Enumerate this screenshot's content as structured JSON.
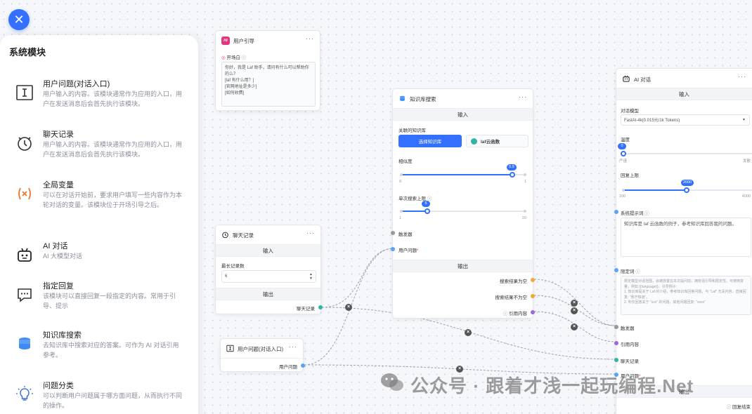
{
  "panel": {
    "title": "系统模块",
    "modules": [
      {
        "name": "用户问题(对话入口)",
        "desc": "用户输入的内容。该模块通常作为应用的入口，用户在发送消息后会首先执行该模块。",
        "icon": "text-cursor-icon"
      },
      {
        "name": "聊天记录",
        "desc": "用户输入的内容。该模块通常作为应用的入口，用户在发送消息后会首先执行该模块。",
        "icon": "history-clock-icon"
      },
      {
        "name": "全局变量",
        "desc": "可以在对话开始前，要求用户填写一些内容作为本轮对话的变量。该模块位于开场引导之后。",
        "icon": "variable-icon"
      },
      {
        "name": "AI 对话",
        "desc": "AI 大模型对话",
        "icon": "robot-icon"
      },
      {
        "name": "指定回复",
        "desc": "该模块可以直接回复一段指定的内容。常用于引导、提示",
        "icon": "reply-bubble-icon"
      },
      {
        "name": "知识库搜索",
        "desc": "去知识库中搜索对应的答案。可作为 AI 对话引用参考。",
        "icon": "database-icon"
      },
      {
        "name": "问题分类",
        "desc": "可以判断用户问题属于哪方面问题，从而执行不同的操作。",
        "icon": "bulb-icon"
      }
    ]
  },
  "guide_node": {
    "title": "用户引导",
    "badge": "Hi",
    "field_label": "开场白",
    "content": "你好，我是 Laf 助手，请问有什么可以帮助你的么？\n[laf 有什么用？]\n[官网地址是多少]\n[如何收费]"
  },
  "history_node": {
    "title": "聊天记录",
    "input_bar": "输入",
    "field_label": "最长记录数",
    "value": "6",
    "output_bar": "输出",
    "output_label": "聊天记录"
  },
  "question_node": {
    "title": "用户问题(对话入口)",
    "output_label": "用户问题"
  },
  "kb_node": {
    "title": "知识库搜索",
    "input_bar": "输入",
    "kb_label": "关联的知识库",
    "select_button": "选择知识库",
    "kb_chip": "laf云函数",
    "similarity_label": "相似度",
    "similarity": {
      "min": "0",
      "max": "1",
      "value": 0.9,
      "tip": "0.9"
    },
    "limit_label": "单次搜索上限",
    "limit": {
      "min": "1",
      "max": "20",
      "value": 5,
      "tip": "5"
    },
    "trigger_label": "触发器",
    "question_label": "用户问题",
    "required_mark": "*",
    "output_bar": "输出",
    "outputs": [
      "搜索结果为空",
      "搜索结果不为空",
      "引用内容"
    ]
  },
  "ai_node": {
    "title": "AI 对话",
    "input_bar": "输入",
    "model_label": "对话模型",
    "model_value": "FastAI-4k(0.015元/1k Tokens)",
    "temp_label": "温度",
    "temp": {
      "value": 0,
      "tip": "0",
      "min": "严谨",
      "max": "发散"
    },
    "reply_label": "回复上限",
    "reply": {
      "value": 2000,
      "tip": "2000",
      "min": "100",
      "max": "4000"
    },
    "prompt_label": "系统提示词",
    "prompt_value": "知识库是 laf 云函数的例子，参考知识库回答我的问题。",
    "limit_label": "限定词",
    "limit_placeholder": "限定模型对话范围，会被放置在本次提问前，拥有强引导和限定性。可使用变量，例如 {{language}}。引导例子:\n1. 知识库是关于 Laf 的介绍，参考知识库回答问题，与 \"Laf\" 无关内容，直接回复: \"我不知道\"。\n2. 你仅回答关于 \"xxx\" 的问题，其他问题回复: \"xxxx\"",
    "inputs": [
      "触发器",
      "引用内容",
      "聊天记录",
      "用户问题"
    ],
    "output_bar": "输出",
    "footer_label": "回复结束"
  },
  "watermark": "公众号 · 跟着才浅一起玩编程.Net",
  "colors": {
    "accent": "#3370ff",
    "port_orange": "#f1a53a",
    "port_purple": "#9b6ad8",
    "port_blue": "#5aa4f5"
  }
}
